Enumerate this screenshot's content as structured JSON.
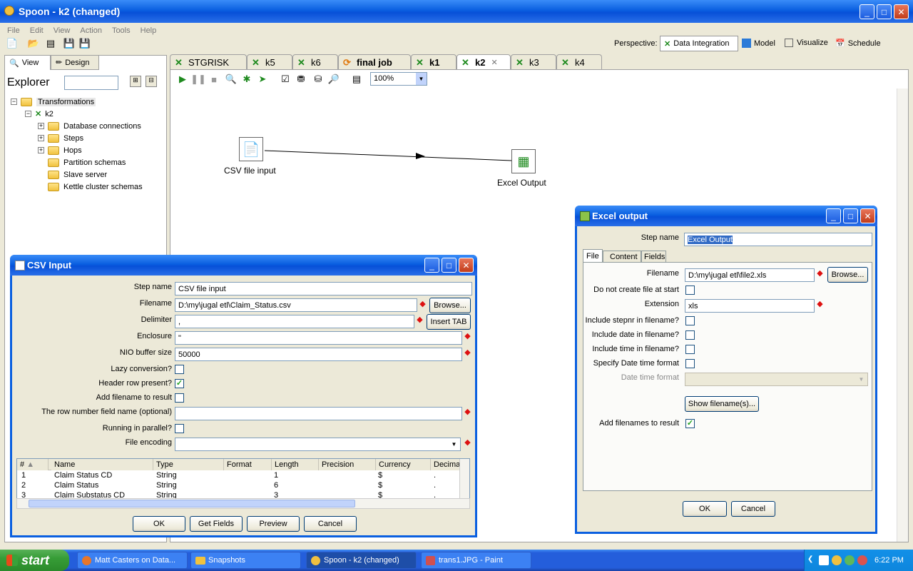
{
  "window": {
    "title": "Spoon - k2 (changed)"
  },
  "menu": [
    "File",
    "Edit",
    "View",
    "Action",
    "Tools",
    "Help"
  ],
  "perspective": {
    "label": "Perspective:",
    "items": [
      "Data Integration",
      "Model",
      "Visualize",
      "Schedule"
    ]
  },
  "left_panel": {
    "tabs": [
      "View",
      "Design"
    ],
    "explorer_label": "Explorer",
    "search_value": "",
    "tree": {
      "root": "Transformations",
      "child": "k2",
      "items": [
        "Database connections",
        "Steps",
        "Hops",
        "Partition schemas",
        "Slave server",
        "Kettle cluster schemas"
      ]
    }
  },
  "tabs": [
    "STGRISK",
    "k5",
    "k6",
    "final job",
    "k1",
    "k2",
    "k3",
    "k4"
  ],
  "active_tab": "k2",
  "zoom": "100%",
  "canvas": {
    "nodes": [
      "CSV file input",
      "Excel Output"
    ]
  },
  "csv_dialog": {
    "title": "CSV Input",
    "fields": {
      "step_name_label": "Step name",
      "step_name": "CSV file input",
      "filename_label": "Filename",
      "filename": "D:\\my\\jugal etl\\Claim_Status.csv",
      "delimiter_label": "Delimiter",
      "delimiter": ",",
      "enclosure_label": "Enclosure",
      "enclosure": "\"",
      "nio_label": "NIO buffer size",
      "nio": "50000",
      "lazy_label": "Lazy conversion?",
      "header_label": "Header row present?",
      "addfile_label": "Add filename to result",
      "rownum_label": "The row number field name (optional)",
      "rownum": "",
      "parallel_label": "Running in parallel?",
      "encoding_label": "File encoding",
      "encoding": ""
    },
    "checks": {
      "lazy": false,
      "header": true,
      "addfile": false,
      "parallel": false
    },
    "buttons": {
      "browse": "Browse...",
      "insert_tab": "Insert TAB",
      "ok": "OK",
      "get_fields": "Get Fields",
      "preview": "Preview",
      "cancel": "Cancel"
    },
    "table": {
      "headers": [
        "#",
        "Name",
        "Type",
        "Format",
        "Length",
        "Precision",
        "Currency",
        "Decima"
      ],
      "rows": [
        [
          "1",
          "Claim Status CD",
          "String",
          "",
          "1",
          "",
          "$",
          "."
        ],
        [
          "2",
          "Claim Status",
          "String",
          "",
          "6",
          "",
          "$",
          "."
        ],
        [
          "3",
          "Claim Substatus CD",
          "String",
          "",
          "3",
          "",
          "$",
          "."
        ]
      ]
    }
  },
  "excel_dialog": {
    "title": "Excel output",
    "step_name_label": "Step name",
    "step_name": "Excel Output",
    "tabs": [
      "File",
      "Content",
      "Fields"
    ],
    "filename_label": "Filename",
    "filename": "D:\\my\\jugal etl\\file2.xls",
    "nocreate_label": "Do not create file at start",
    "extension_label": "Extension",
    "extension": "xls",
    "stepnr_label": "Include stepnr in filename?",
    "date_label": "Include date in filename?",
    "time_label": "Include time in filename?",
    "spec_label": "Specify Date time format",
    "dtf_label": "Date time format",
    "dtf": "",
    "show_button": "Show filename(s)...",
    "addres_label": "Add filenames to result",
    "checks": {
      "nocreate": false,
      "stepnr": false,
      "date": false,
      "time": false,
      "spec": false,
      "addres": true
    },
    "buttons": {
      "browse": "Browse...",
      "ok": "OK",
      "cancel": "Cancel"
    }
  },
  "taskbar": {
    "start": "start",
    "tasks": [
      "Matt Casters on Data...",
      "Snapshots",
      "Spoon - k2 (changed)",
      "trans1.JPG - Paint"
    ],
    "clock": "6:22 PM"
  }
}
